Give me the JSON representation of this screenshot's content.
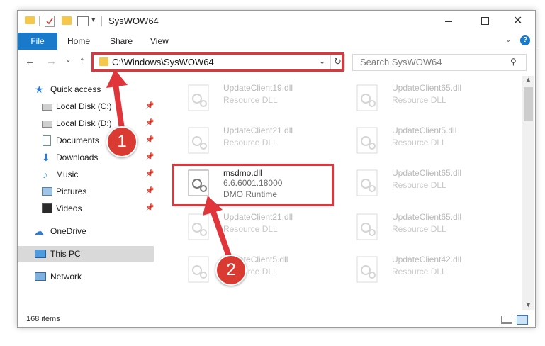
{
  "window": {
    "title": "SysWOW64",
    "qat_icons": [
      "folder-icon",
      "properties-icon",
      "new-folder-icon",
      "customize-icon"
    ],
    "controls": [
      "minimize-icon",
      "maximize-icon",
      "close-icon"
    ]
  },
  "ribbon": {
    "file": "File",
    "home": "Home",
    "share": "Share",
    "view": "View"
  },
  "nav": {
    "address": "C:\\Windows\\SysWOW64",
    "search_placeholder": "Search SysWOW64"
  },
  "sidebar": {
    "quick_access": "Quick access",
    "items": [
      {
        "label": "Local Disk (C:)",
        "icon": "drive-icon"
      },
      {
        "label": "Local Disk (D:)",
        "icon": "drive-icon"
      },
      {
        "label": "Documents",
        "icon": "documents-icon"
      },
      {
        "label": "Downloads",
        "icon": "downloads-icon"
      },
      {
        "label": "Music",
        "icon": "music-icon"
      },
      {
        "label": "Pictures",
        "icon": "pictures-icon"
      },
      {
        "label": "Videos",
        "icon": "videos-icon"
      }
    ],
    "onedrive": "OneDrive",
    "this_pc": "This PC",
    "network": "Network"
  },
  "files": {
    "left": [
      {
        "name": "UpdateClient19.dll",
        "desc": "Resource DLL"
      },
      {
        "name": "UpdateClient21.dll",
        "desc": "Resource DLL"
      },
      {
        "name": "msdmo.dll",
        "version": "6.6.6001.18000",
        "desc": "DMO Runtime"
      },
      {
        "name": "UpdateClient21.dll",
        "desc": "Resource DLL"
      },
      {
        "name": "UpdateClient5.dll",
        "desc": "Resource DLL"
      }
    ],
    "right": [
      {
        "name": "UpdateClient65.dll",
        "desc": "Resource DLL"
      },
      {
        "name": "UpdateClient5.dll",
        "desc": "Resource DLL"
      },
      {
        "name": "UpdateClient65.dll",
        "desc": "Resource DLL"
      },
      {
        "name": "UpdateClient65.dll",
        "desc": "Resource DLL"
      },
      {
        "name": "UpdateClient42.dll",
        "desc": "Resource DLL"
      }
    ]
  },
  "status": {
    "count": "168 items"
  },
  "callouts": {
    "one": "1",
    "two": "2",
    "color": "#e0353a"
  }
}
